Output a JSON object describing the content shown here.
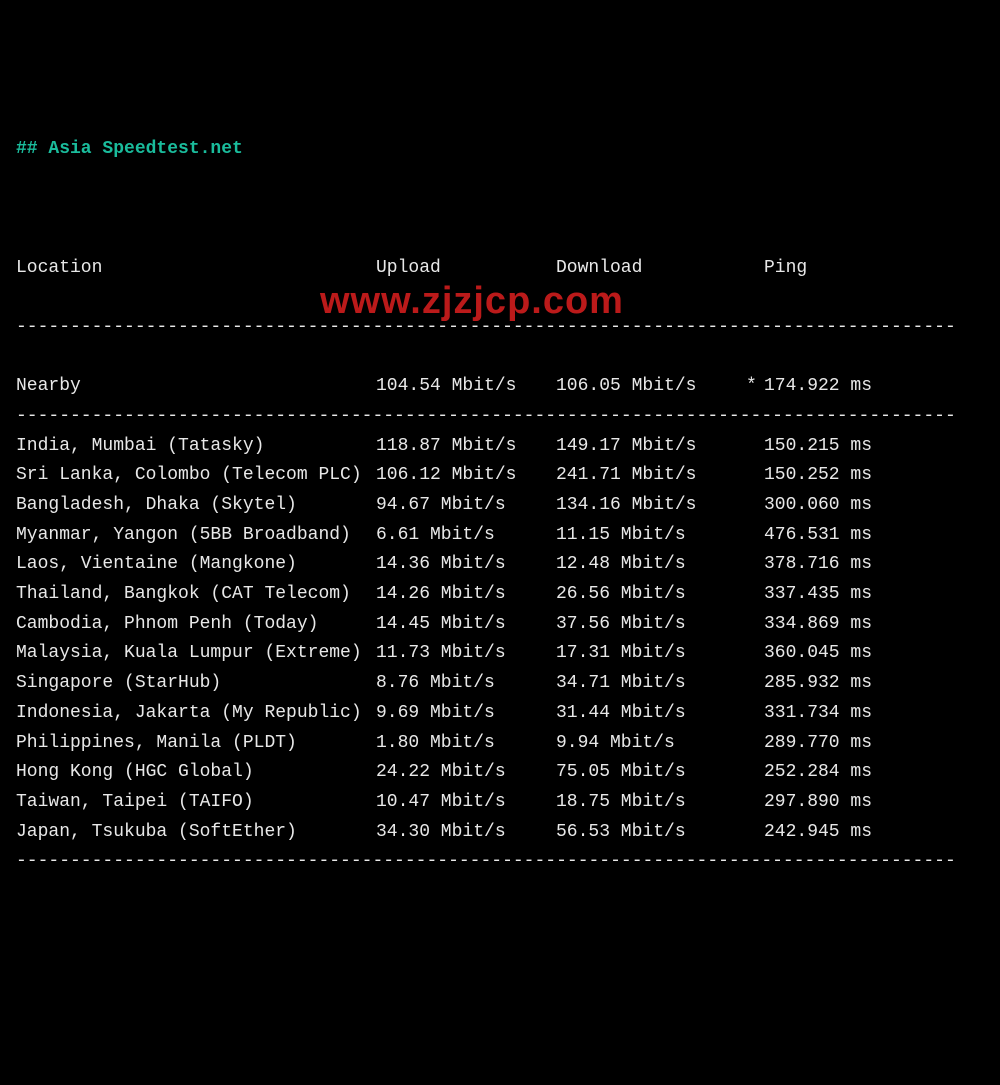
{
  "chart_data": {
    "type": "table",
    "title": "## Asia Speedtest.net",
    "columns": [
      "Location",
      "Upload",
      "Download",
      "Ping"
    ],
    "rows": [
      {
        "location": "Nearby",
        "upload": "104.54 Mbit/s",
        "download": "106.05 Mbit/s",
        "ping": "174.922 ms",
        "star": "*"
      },
      {
        "location": "India, Mumbai (Tatasky)",
        "upload": "118.87 Mbit/s",
        "download": "149.17 Mbit/s",
        "ping": "150.215 ms",
        "star": ""
      },
      {
        "location": "Sri Lanka, Colombo (Telecom PLC)",
        "upload": "106.12 Mbit/s",
        "download": "241.71 Mbit/s",
        "ping": "150.252 ms",
        "star": ""
      },
      {
        "location": "Bangladesh, Dhaka (Skytel)",
        "upload": "94.67 Mbit/s",
        "download": "134.16 Mbit/s",
        "ping": "300.060 ms",
        "star": ""
      },
      {
        "location": "Myanmar, Yangon (5BB Broadband)",
        "upload": "6.61 Mbit/s",
        "download": "11.15 Mbit/s",
        "ping": "476.531 ms",
        "star": ""
      },
      {
        "location": "Laos, Vientaine (Mangkone)",
        "upload": "14.36 Mbit/s",
        "download": "12.48 Mbit/s",
        "ping": "378.716 ms",
        "star": ""
      },
      {
        "location": "Thailand, Bangkok (CAT Telecom)",
        "upload": "14.26 Mbit/s",
        "download": "26.56 Mbit/s",
        "ping": "337.435 ms",
        "star": ""
      },
      {
        "location": "Cambodia, Phnom Penh (Today)",
        "upload": "14.45 Mbit/s",
        "download": "37.56 Mbit/s",
        "ping": "334.869 ms",
        "star": ""
      },
      {
        "location": "Malaysia, Kuala Lumpur (Extreme)",
        "upload": "11.73 Mbit/s",
        "download": "17.31 Mbit/s",
        "ping": "360.045 ms",
        "star": ""
      },
      {
        "location": "Singapore (StarHub)",
        "upload": "8.76 Mbit/s",
        "download": "34.71 Mbit/s",
        "ping": "285.932 ms",
        "star": ""
      },
      {
        "location": "Indonesia, Jakarta (My Republic)",
        "upload": "9.69 Mbit/s",
        "download": "31.44 Mbit/s",
        "ping": "331.734 ms",
        "star": ""
      },
      {
        "location": "Philippines, Manila (PLDT)",
        "upload": "1.80 Mbit/s",
        "download": "9.94 Mbit/s",
        "ping": "289.770 ms",
        "star": ""
      },
      {
        "location": "Hong Kong (HGC Global)",
        "upload": "24.22 Mbit/s",
        "download": "75.05 Mbit/s",
        "ping": "252.284 ms",
        "star": ""
      },
      {
        "location": "Taiwan, Taipei (TAIFO)",
        "upload": "10.47 Mbit/s",
        "download": "18.75 Mbit/s",
        "ping": "297.890 ms",
        "star": ""
      },
      {
        "location": "Japan, Tsukuba (SoftEther)",
        "upload": "34.30 Mbit/s",
        "download": "56.53 Mbit/s",
        "ping": "242.945 ms",
        "star": ""
      }
    ]
  },
  "divider": "---------------------------------------------------------------------------------------",
  "watermark": "www.zjzjcp.com"
}
